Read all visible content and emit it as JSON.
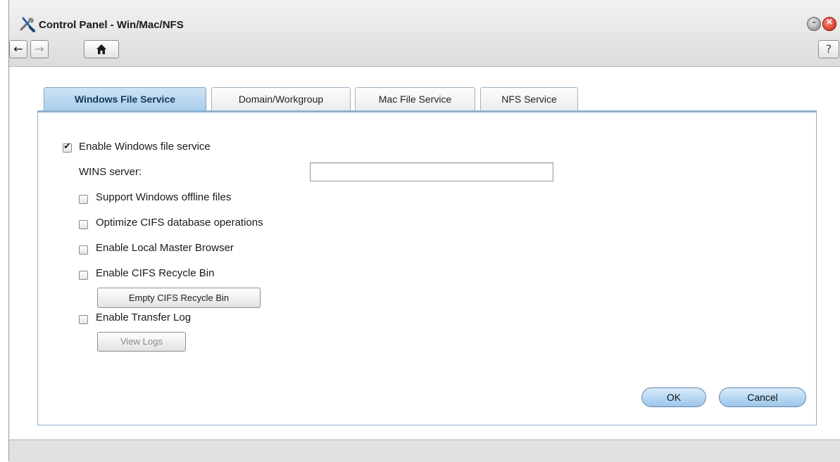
{
  "window": {
    "title": "Control Panel - Win/Mac/NFS",
    "app_icon": "wrench-screwdriver-icon",
    "minimize_glyph": "–",
    "close_glyph": "×"
  },
  "toolbar": {
    "back_glyph": "←",
    "forward_glyph": "→",
    "home_glyph": "⌂",
    "help_glyph": "?"
  },
  "tabs": [
    {
      "label": "Windows File Service",
      "active": true
    },
    {
      "label": "Domain/Workgroup",
      "active": false
    },
    {
      "label": "Mac File Service",
      "active": false
    },
    {
      "label": "NFS Service",
      "active": false
    }
  ],
  "form": {
    "enable_windows": {
      "label": "Enable Windows file service",
      "checked": true
    },
    "wins_server": {
      "label": "WINS server:",
      "value": ""
    },
    "offline_files": {
      "label": "Support Windows offline files",
      "checked": false
    },
    "optimize_cifs": {
      "label": "Optimize CIFS database operations",
      "checked": false
    },
    "local_master": {
      "label": "Enable Local Master Browser",
      "checked": false
    },
    "recycle_bin": {
      "label": "Enable CIFS Recycle Bin",
      "checked": false
    },
    "empty_recycle_button": "Empty CIFS Recycle Bin",
    "transfer_log": {
      "label": "Enable Transfer Log",
      "checked": false
    },
    "view_logs_button": "View Logs"
  },
  "actions": {
    "ok_label": "OK",
    "cancel_label": "Cancel"
  },
  "colors": {
    "active_tab": "#a9cdea",
    "close_button": "#c81e0e",
    "pill_button": "#9cc6ea"
  }
}
